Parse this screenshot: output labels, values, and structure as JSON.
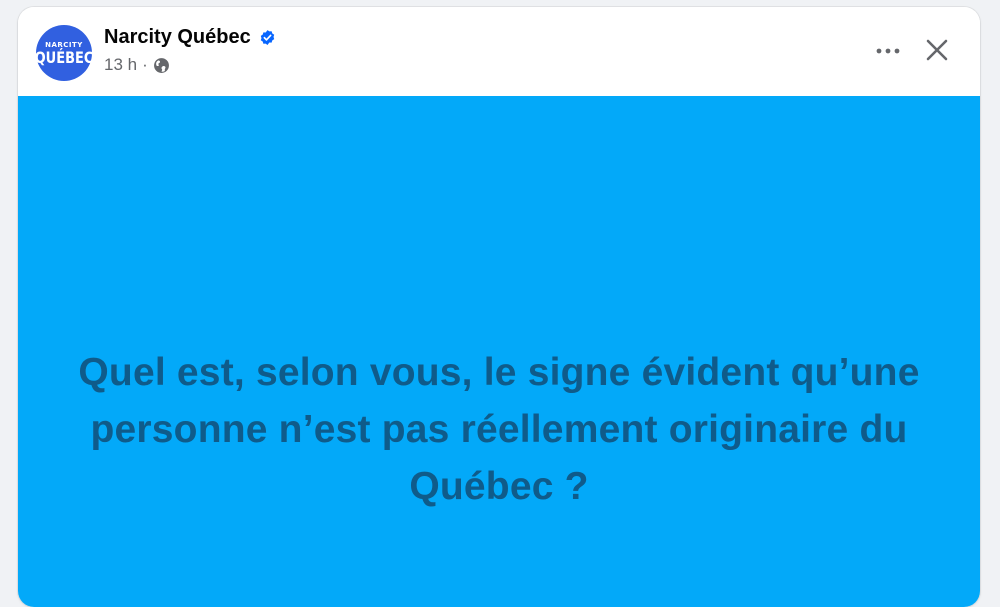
{
  "post": {
    "page_name": "Narcity Québec",
    "avatar": {
      "line1": "NARCITY",
      "line2": "QUÉBEC"
    },
    "time": "13 h",
    "separator": "·",
    "audience_icon": "globe-icon",
    "verified_icon": "verified-badge-icon",
    "text": "Quel est, selon vous, le signe évident qu’une personne n’est pas réellement originaire du Québec ?"
  },
  "colors": {
    "avatar_bg": "#3160e0",
    "post_background": "#03a9f9",
    "post_text": "#0f5b8a",
    "verified": "#0866ff"
  }
}
